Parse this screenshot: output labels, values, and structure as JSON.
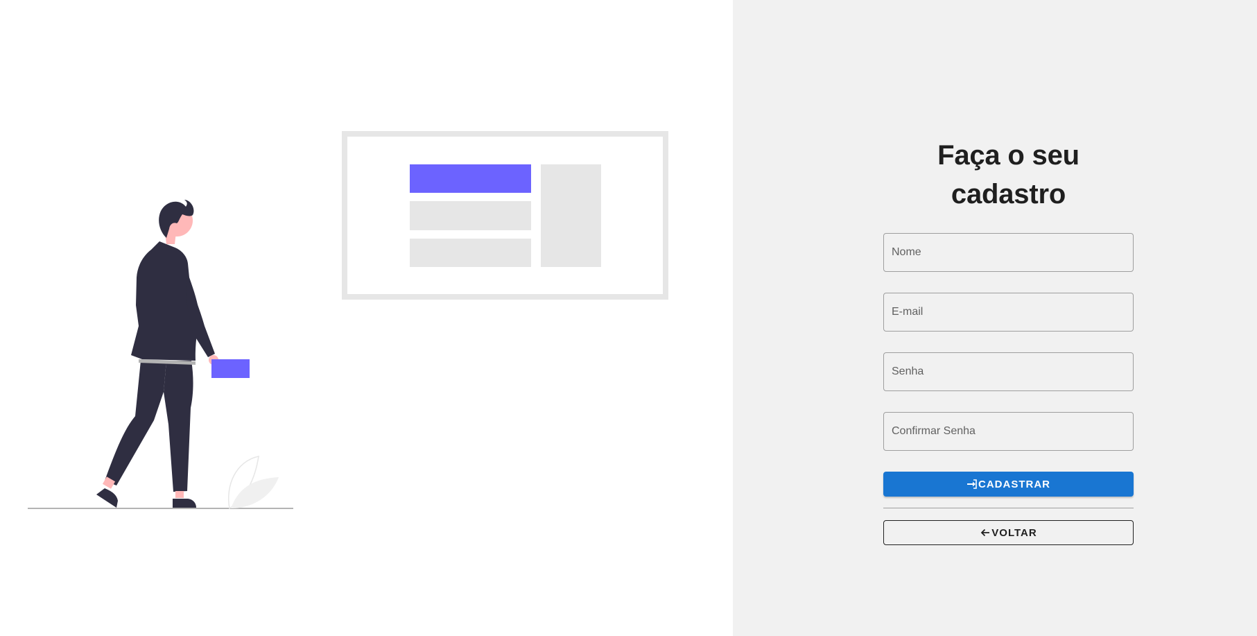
{
  "colors": {
    "accent": "#6c63ff",
    "primary_button": "#1976d2",
    "right_background": "#f1f1f1",
    "left_background": "#ffffff",
    "illustration_dark": "#2f2e41",
    "illustration_skin": "#ffb8b8",
    "illustration_gray": "#e6e6e6"
  },
  "form": {
    "title": "Faça o seu cadastro",
    "fields": {
      "name_placeholder": "Nome",
      "email_placeholder": "E-mail",
      "password_placeholder": "Senha",
      "confirm_password_placeholder": "Confirmar Senha"
    },
    "submit_label": "CADASTRAR",
    "submit_icon": "login-icon",
    "back_label": "VOLTAR",
    "back_icon": "arrow-left-icon"
  },
  "illustration": {
    "description_icon": "person-with-card-illustration"
  }
}
